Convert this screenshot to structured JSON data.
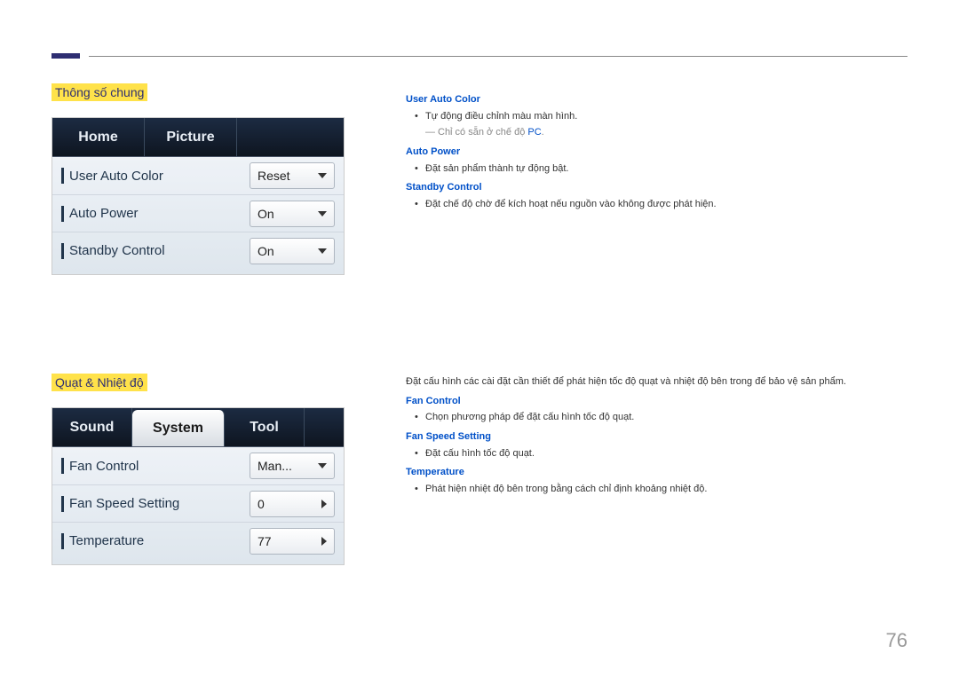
{
  "sections": {
    "s1": {
      "title": "Thông số chung"
    },
    "s2": {
      "title": "Quạt & Nhiệt độ"
    }
  },
  "ui1": {
    "tabs": {
      "t0": "Home",
      "t1": "Picture"
    },
    "rows": {
      "r0": {
        "label": "User Auto Color",
        "value": "Reset"
      },
      "r1": {
        "label": "Auto Power",
        "value": "On"
      },
      "r2": {
        "label": "Standby Control",
        "value": "On"
      }
    }
  },
  "ui2": {
    "tabs": {
      "t0": "Sound",
      "t1": "System",
      "t2": "Tool"
    },
    "rows": {
      "r0": {
        "label": "Fan Control",
        "value": "Man..."
      },
      "r1": {
        "label": "Fan Speed Setting",
        "value": "0"
      },
      "r2": {
        "label": "Temperature",
        "value": "77"
      }
    }
  },
  "desc1": {
    "h0": "User Auto Color",
    "b0": "Tự động điều chỉnh màu màn hình.",
    "n0a": "Chỉ có sẵn ở chế độ ",
    "n0b": "PC",
    "n0c": ".",
    "h1": "Auto Power",
    "b1": "Đặt sản phẩm thành tự động bật.",
    "h2": "Standby Control",
    "b2": "Đặt chế độ chờ để kích hoạt nếu nguồn vào không được phát hiện."
  },
  "desc2": {
    "intro": "Đặt cấu hình các cài đặt cần thiết để phát hiện tốc độ quạt và nhiệt độ bên trong để bảo vệ sản phẩm.",
    "h0": "Fan Control",
    "b0": "Chọn phương pháp để đặt cấu hình tốc độ quạt.",
    "h1": "Fan Speed Setting",
    "b1": "Đặt cấu hình tốc độ quạt.",
    "h2": "Temperature",
    "b2": "Phát hiện nhiệt độ bên trong bằng cách chỉ định khoảng nhiệt độ."
  },
  "page": "76"
}
